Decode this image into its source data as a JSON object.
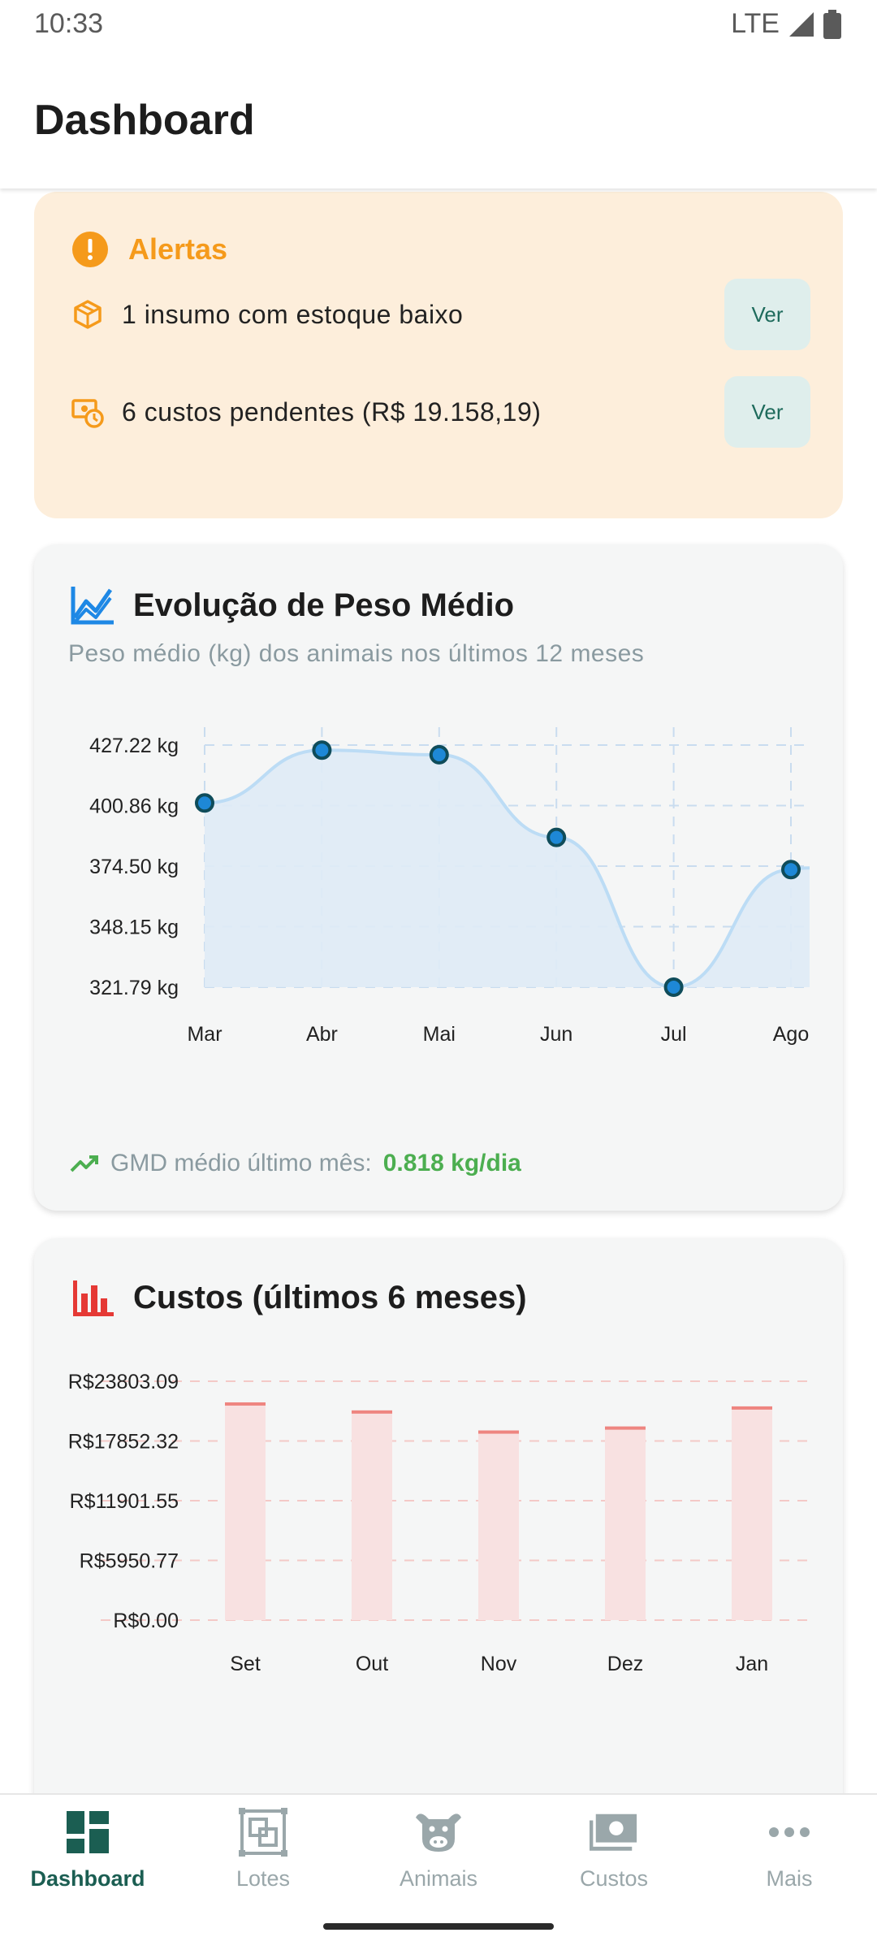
{
  "status_bar": {
    "time": "10:33",
    "network": "LTE"
  },
  "app_bar": {
    "title": "Dashboard"
  },
  "alerts": {
    "title": "Alertas",
    "icon": "alert-circle-icon",
    "items": [
      {
        "icon": "package-icon",
        "text": "1 insumo com estoque baixo",
        "action": "Ver"
      },
      {
        "icon": "pending-payment-icon",
        "text": "6 custos pendentes (R$ 19.158,19)",
        "action": "Ver"
      }
    ],
    "accent": "#f59a1b"
  },
  "weight_card": {
    "title": "Evolução de Peso Médio",
    "subtitle": "Peso médio (kg) dos animais nos últimos 12 meses",
    "icon": "line-chart-icon",
    "gmd_label": "GMD médio último mês:",
    "gmd_value": "0.818 kg/dia"
  },
  "costs_card": {
    "title": "Custos (últimos 6 meses)",
    "icon": "bar-chart-icon"
  },
  "chart_data": [
    {
      "type": "area",
      "categories": [
        "Mar",
        "Abr",
        "Mai",
        "Jun",
        "Jul",
        "Ago"
      ],
      "values": [
        402,
        425,
        423,
        387,
        321.79,
        373
      ],
      "y_ticks": [
        "427.22 kg",
        "400.86 kg",
        "374.50 kg",
        "348.15 kg",
        "321.79 kg"
      ],
      "ylim": [
        321.79,
        427.22
      ],
      "grid": true,
      "line_color": "#bcdcf5",
      "fill_color": "#dfebf6",
      "point_color": "#1e88d6"
    },
    {
      "type": "bar",
      "categories": [
        "Set",
        "Out",
        "Nov",
        "Dez",
        "Jan"
      ],
      "values": [
        21700,
        20900,
        18900,
        19300,
        21300
      ],
      "y_ticks": [
        "R$23803.09",
        "R$17852.32",
        "R$11901.55",
        "R$5950.77",
        "R$0.00"
      ],
      "ylim": [
        0,
        23803.09
      ],
      "grid": true,
      "bar_color": "#f8e1e1",
      "bar_top_color": "#ee8580"
    }
  ],
  "bottom_nav": {
    "items": [
      {
        "label": "Dashboard",
        "icon": "dashboard-icon",
        "active": true
      },
      {
        "label": "Lotes",
        "icon": "lots-icon",
        "active": false
      },
      {
        "label": "Animais",
        "icon": "cow-icon",
        "active": false
      },
      {
        "label": "Custos",
        "icon": "money-icon",
        "active": false
      },
      {
        "label": "Mais",
        "icon": "more-icon",
        "active": false
      }
    ],
    "active_color": "#1b5e52",
    "inactive_color": "#9aa7aa"
  }
}
